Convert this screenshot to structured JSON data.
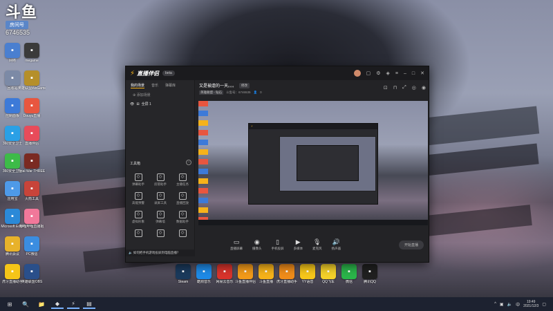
{
  "badge": {
    "logo": "斗鱼",
    "room_label": "房间号",
    "room_id": "6746535"
  },
  "desktop_left": [
    {
      "label": "网络",
      "icon": "network-icon",
      "color": "#4a7fd0"
    },
    {
      "label": "megame",
      "icon": "megame-icon",
      "color": "#3a3a3a"
    },
    {
      "label": "回收站",
      "icon": "recycle-bin-icon",
      "color": "#7c8aa6"
    },
    {
      "label": "英雄联盟WeGame版",
      "icon": "lol-icon",
      "color": "#b58f2a"
    },
    {
      "label": "控制面板",
      "icon": "control-panel-icon",
      "color": "#3d7ad8"
    },
    {
      "label": "Douyu直播",
      "icon": "douyu-icon",
      "color": "#e8563f"
    },
    {
      "label": "360安全卫士",
      "icon": "360-safe-icon",
      "color": "#2aa0e6"
    },
    {
      "label": "直播伴侣",
      "icon": "live-companion-icon",
      "color": "#e84b5a"
    },
    {
      "label": "360安全卫士",
      "icon": "360-guard-icon",
      "color": "#3dbb48"
    },
    {
      "label": "Total War THREE KI...",
      "icon": "total-war-icon",
      "color": "#7a2a22"
    },
    {
      "label": "应用宝",
      "icon": "app-store-icon",
      "color": "#4e9ae8"
    },
    {
      "label": "火箭工具",
      "icon": "rocket-tool-icon",
      "color": "#c8443a"
    },
    {
      "label": "Microsoft Edge",
      "icon": "edge-icon",
      "color": "#2b89d8"
    },
    {
      "label": "哔哩哔哩直播姬",
      "icon": "bilibili-icon",
      "color": "#f1789a"
    },
    {
      "label": "腾讯会议",
      "icon": "meeting-icon",
      "color": "#e8b22a"
    },
    {
      "label": "PC微信",
      "icon": "photo-icon",
      "color": "#3b8de0"
    },
    {
      "label": "虎牙直播助手",
      "icon": "huya-icon",
      "color": "#f5c518"
    },
    {
      "label": "英雄联盟OBS",
      "icon": "obs-icon",
      "color": "#2a4f8a"
    }
  ],
  "desktop_bottom": [
    {
      "label": "Steam",
      "icon": "steam-icon",
      "color": "#1b3a5c"
    },
    {
      "label": "酷狗音乐",
      "icon": "kugou-icon",
      "color": "#1e8ae6"
    },
    {
      "label": "网易云音乐",
      "icon": "netease-music-icon",
      "color": "#d8342c"
    },
    {
      "label": "斗鱼直播伴侣",
      "icon": "douyu-companion-icon",
      "color": "#f29a1a"
    },
    {
      "label": "斗鱼直播",
      "icon": "douyu-live-icon",
      "color": "#f6b21a"
    },
    {
      "label": "虎牙直播助手",
      "icon": "huya-assist-icon",
      "color": "#f08c1a"
    },
    {
      "label": "YY语音",
      "icon": "yy-icon",
      "color": "#f6c61a"
    },
    {
      "label": "QQ飞车",
      "icon": "qq-speed-icon",
      "color": "#f5d12a"
    },
    {
      "label": "微信",
      "icon": "wechat-icon",
      "color": "#2bb54a"
    },
    {
      "label": "腾讯QQ",
      "icon": "qq-icon",
      "color": "#202020"
    }
  ],
  "app": {
    "brand": "直播伴侣",
    "version_badge": "beta",
    "tabs": [
      "我的场景",
      "音乐",
      "弹幕库"
    ],
    "add_scene": "添加场景",
    "scene_name": "全屏 1",
    "tools_title": "工具箱",
    "tools": [
      {
        "label": "弹幕助手",
        "icon": "danmaku-icon"
      },
      {
        "label": "房管助手",
        "icon": "admin-icon"
      },
      {
        "label": "主播任务",
        "icon": "task-icon"
      },
      {
        "label": "高能预警",
        "icon": "alert-icon"
      },
      {
        "label": "录屏工具",
        "icon": "record-icon"
      },
      {
        "label": "直播回放",
        "icon": "replay-icon"
      },
      {
        "label": "虚拟形象",
        "icon": "avatar-icon"
      },
      {
        "label": "弹幕墙",
        "icon": "wall-icon"
      },
      {
        "label": "数据助手",
        "icon": "data-icon"
      },
      {
        "label": "",
        "icon": "more1-icon"
      },
      {
        "label": "",
        "icon": "more2-icon"
      },
      {
        "label": "",
        "icon": "more3-icon"
      }
    ],
    "notice": "如何把手机游戏投屏到电脑直播？",
    "stream_title": "又是被虐的一天。。。",
    "edit_label": "修改",
    "category": "英雄联盟 - 钻石",
    "room_label": "斗鱼号：6746535",
    "viewers": "0",
    "controls": [
      {
        "label": "直播屏幕",
        "icon": "screen-icon"
      },
      {
        "label": "摄像头",
        "icon": "camera-icon"
      },
      {
        "label": "手机投屏",
        "icon": "phone-cast-icon"
      },
      {
        "label": "多媒体",
        "icon": "media-icon"
      },
      {
        "label": "麦克风",
        "icon": "mic-icon"
      },
      {
        "label": "扬声器",
        "icon": "speaker-icon"
      }
    ],
    "start_button": "开始直播"
  },
  "taskbar": {
    "items": [
      "start-icon",
      "search-icon",
      "explorer-icon",
      "douyu-task-icon",
      "companion-task-icon",
      "folder-task-icon"
    ],
    "time": "19:49",
    "date": "2021/12/3"
  }
}
